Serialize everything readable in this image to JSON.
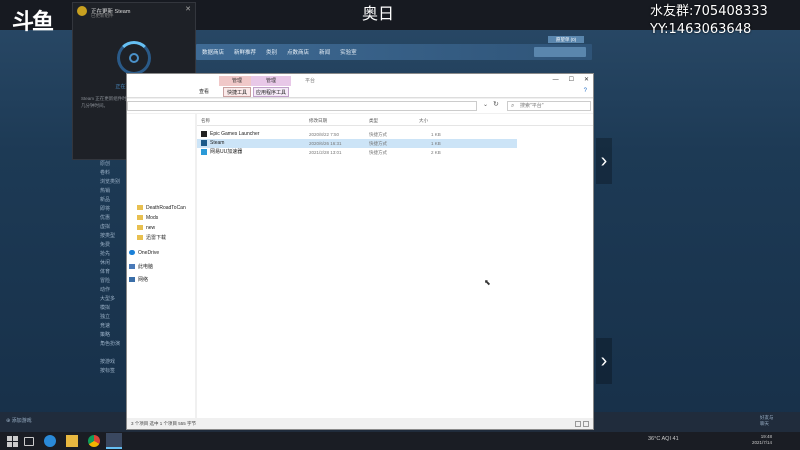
{
  "overlay": {
    "logo_text": "斗鱼",
    "streamer": "奥日",
    "fan_group": "水友群:705408333",
    "yy": "YY:1463063648"
  },
  "steam": {
    "store_nav": [
      "数据商店",
      "新鲜推荐",
      "类别",
      "点数商店",
      "新闻",
      "实验室"
    ],
    "wishlist_label": "愿望单 (0)",
    "sidebar": [
      "原创",
      "卷料",
      "浏览类别",
      "热销",
      "新品",
      "即将",
      "优惠",
      "虚拟",
      "按类型",
      "免费",
      "抢先",
      "休闲",
      "体育",
      "冒险",
      "动作",
      "大型多",
      "模拟",
      "独立",
      "竞速",
      "策略",
      "角色扮演",
      "",
      "按游戏",
      "按标签"
    ],
    "add_game": "添加游戏",
    "friends": "好友与聊天"
  },
  "update_window": {
    "title": "正在更新 Steam",
    "subtitle": "已更新组件",
    "status": "正在更新组件中...",
    "description": "Steam 正在更新组件时必须保持联机连接，可能需要几分钟时间。"
  },
  "explorer": {
    "context_tab_1": "管理",
    "context_tab_2": "管理",
    "folder_name": "平台",
    "ribbon_view": "查看",
    "ribbon_shortcut_tools": "快捷工具",
    "ribbon_app_tools": "应用程序工具",
    "search_placeholder": "搜索\"平台\"",
    "nav": {
      "items": [
        {
          "label": "DeathRoadToCan",
          "icon": "folder"
        },
        {
          "label": "Mods",
          "icon": "folder"
        },
        {
          "label": "new",
          "icon": "folder"
        },
        {
          "label": "迅雷下载",
          "icon": "folder"
        },
        {
          "label": "OneDrive",
          "icon": "cloud"
        },
        {
          "label": "此电脑",
          "icon": "pc"
        },
        {
          "label": "网络",
          "icon": "network"
        }
      ]
    },
    "columns": {
      "name": "名称",
      "date": "修改日期",
      "type": "类型",
      "size": "大小"
    },
    "files": [
      {
        "name": "Epic Games Launcher",
        "date": "2020/8/22 7:50",
        "type": "快捷方式",
        "size": "1 KB",
        "icon_color": "#222222"
      },
      {
        "name": "Steam",
        "date": "2020/6/26 16:31",
        "type": "快捷方式",
        "size": "1 KB",
        "icon_color": "#1b5a8a"
      },
      {
        "name": "网易UU加速器",
        "date": "2021/2/28 13:01",
        "type": "快捷方式",
        "size": "2 KB",
        "icon_color": "#2a9ad8"
      }
    ],
    "status": "3 个项目    选中 1 个项目  555 字节"
  },
  "taskbar": {
    "tray": "36°C  AQI 41",
    "time": "19:48",
    "date": "2021/7/14"
  }
}
